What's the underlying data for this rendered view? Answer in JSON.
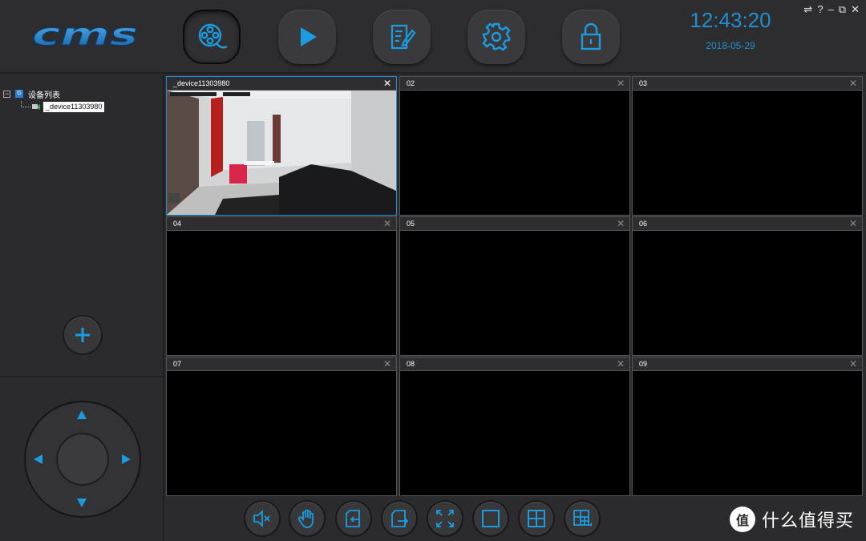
{
  "app": {
    "logo_text": "cms"
  },
  "header": {
    "nav": [
      {
        "name": "live-view",
        "icon": "film-reel-icon",
        "active": true
      },
      {
        "name": "playback",
        "icon": "play-icon",
        "active": false
      },
      {
        "name": "log",
        "icon": "edit-document-icon",
        "active": false
      },
      {
        "name": "settings",
        "icon": "gear-icon",
        "active": false
      },
      {
        "name": "lock",
        "icon": "lock-icon",
        "active": false
      }
    ],
    "clock": "12:43:20",
    "date": "2018-05-29",
    "window_controls": {
      "network": "⇌",
      "help": "?",
      "minimize": "–",
      "restore": "⧉",
      "close": "✕"
    }
  },
  "sidebar": {
    "tree_root_label": "设备列表",
    "tree_root_toggle": "−",
    "tree_root_icon": "G",
    "devices": [
      "_device11303980"
    ],
    "add_label": "+"
  },
  "grid": {
    "cells": [
      {
        "title": "_device11303980",
        "close": "✕",
        "has_video": true,
        "selected": true
      },
      {
        "title": "02",
        "close": "✕",
        "has_video": false
      },
      {
        "title": "03",
        "close": "✕",
        "has_video": false
      },
      {
        "title": "04",
        "close": "✕",
        "has_video": false
      },
      {
        "title": "05",
        "close": "✕",
        "has_video": false
      },
      {
        "title": "06",
        "close": "✕",
        "has_video": false
      },
      {
        "title": "07",
        "close": "✕",
        "has_video": false
      },
      {
        "title": "08",
        "close": "✕",
        "has_video": false
      },
      {
        "title": "09",
        "close": "✕",
        "has_video": false
      }
    ],
    "video_osd": "2018-05-29 12:43"
  },
  "toolbar": {
    "buttons": [
      "mute-icon",
      "hand-icon",
      "import-icon",
      "export-icon",
      "fullscreen-icon",
      "single-view-icon",
      "quad-view-icon",
      "custom-layout-icon"
    ]
  },
  "watermark": {
    "badge": "值",
    "text": "什么值得买"
  },
  "colors": {
    "accent": "#1f8fd1",
    "background": "#2b2b2d",
    "selected_border": "#2a8fd6"
  }
}
